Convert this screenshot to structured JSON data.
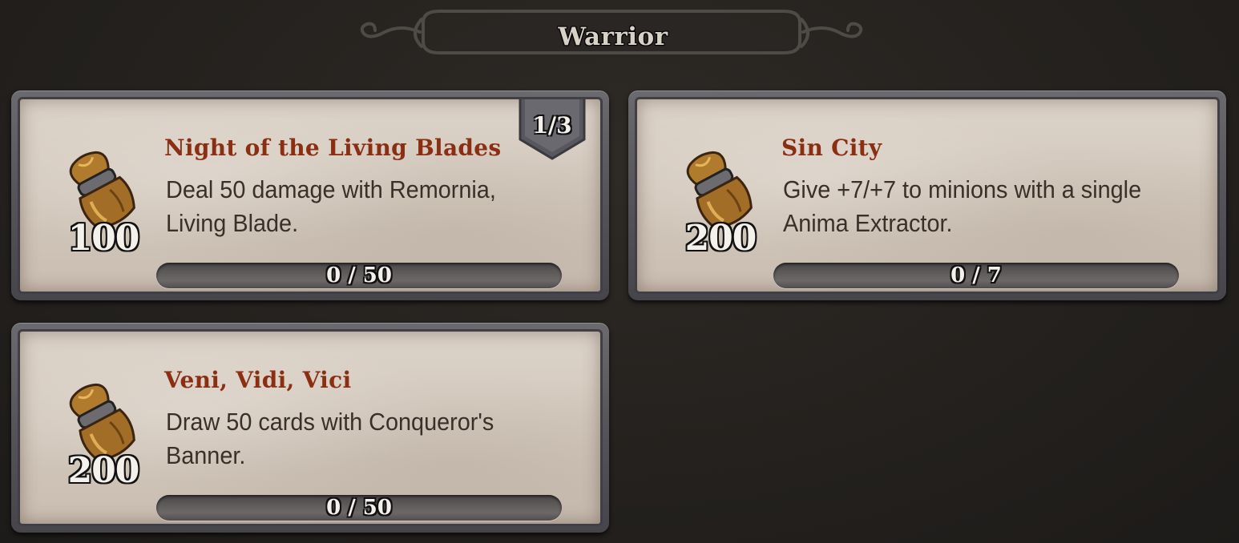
{
  "header": {
    "title": "Warrior"
  },
  "achievements": [
    {
      "title": "Night of the Living Blades",
      "description": "Deal 50 damage with Remornia, Living Blade.",
      "reward": "100",
      "reward_icon": "gold-pouch-icon",
      "progress_text": "0 / 50",
      "progress_fraction": 0,
      "tier": "1/3"
    },
    {
      "title": "Sin City",
      "description": "Give +7/+7 to minions with a single Anima Extractor.",
      "reward": "200",
      "reward_icon": "gold-pouch-icon",
      "progress_text": "0 / 7",
      "progress_fraction": 0
    },
    {
      "title": "Veni, Vidi, Vici",
      "description": "Draw 50 cards with Conqueror's Banner.",
      "reward": "200",
      "reward_icon": "gold-pouch-icon",
      "progress_text": "0 / 50",
      "progress_fraction": 0
    }
  ],
  "colors": {
    "title_text": "#8b2f12",
    "body_text": "#3a3029",
    "parchment": "#d3c8bc",
    "frame": "#55545a",
    "background": "#24211e"
  }
}
